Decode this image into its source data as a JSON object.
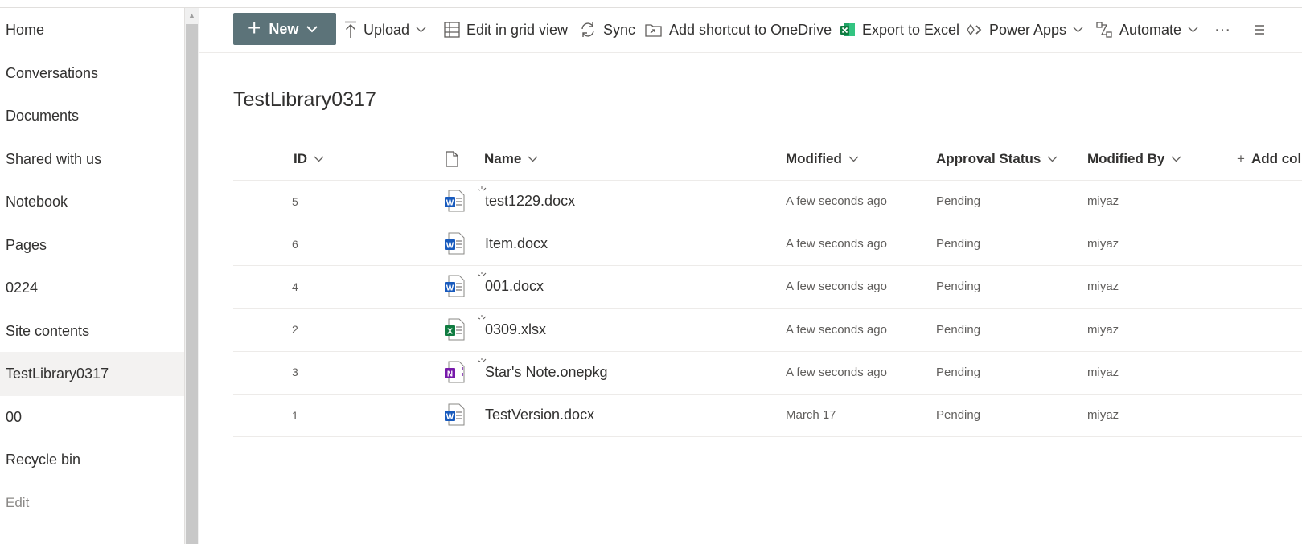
{
  "nav": {
    "items": [
      {
        "label": "Home"
      },
      {
        "label": "Conversations"
      },
      {
        "label": "Documents"
      },
      {
        "label": "Shared with us"
      },
      {
        "label": "Notebook"
      },
      {
        "label": "Pages"
      },
      {
        "label": "0224"
      },
      {
        "label": "Site contents"
      },
      {
        "label": "TestLibrary0317"
      },
      {
        "label": "00"
      },
      {
        "label": "Recycle bin"
      }
    ],
    "selected": "TestLibrary0317",
    "edit_label": "Edit"
  },
  "toolbar": {
    "new_label": "New",
    "upload_label": "Upload",
    "grid_label": "Edit in grid view",
    "sync_label": "Sync",
    "shortcut_label": "Add shortcut to OneDrive",
    "excel_label": "Export to Excel",
    "powerapps_label": "Power Apps",
    "automate_label": "Automate",
    "more_label": "···"
  },
  "library": {
    "title": "TestLibrary0317",
    "columns": {
      "id": "ID",
      "name": "Name",
      "modified": "Modified",
      "approval": "Approval Status",
      "modified_by": "Modified By",
      "add_column": "Add col"
    },
    "rows": [
      {
        "id": "5",
        "name": "test1229.docx",
        "type": "word-icon",
        "modified": "A few seconds ago",
        "approval": "Pending",
        "modified_by": "miyaz",
        "new": true
      },
      {
        "id": "6",
        "name": "Item.docx",
        "type": "word-icon",
        "modified": "A few seconds ago",
        "approval": "Pending",
        "modified_by": "miyaz",
        "new": false
      },
      {
        "id": "4",
        "name": "001.docx",
        "type": "word-icon",
        "modified": "A few seconds ago",
        "approval": "Pending",
        "modified_by": "miyaz",
        "new": true
      },
      {
        "id": "2",
        "name": "0309.xlsx",
        "type": "excel-icon",
        "modified": "A few seconds ago",
        "approval": "Pending",
        "modified_by": "miyaz",
        "new": true
      },
      {
        "id": "3",
        "name": "Star's Note.onepkg",
        "type": "onenote-icon",
        "modified": "A few seconds ago",
        "approval": "Pending",
        "modified_by": "miyaz",
        "new": true
      },
      {
        "id": "1",
        "name": "TestVersion.docx",
        "type": "word-icon",
        "modified": "March 17",
        "approval": "Pending",
        "modified_by": "miyaz",
        "new": false
      }
    ]
  },
  "colors": {
    "new_button": "#5c7379",
    "word": "#185abd",
    "excel": "#107c41",
    "onenote": "#7719aa",
    "selected_nav": "#f3f2f1"
  }
}
